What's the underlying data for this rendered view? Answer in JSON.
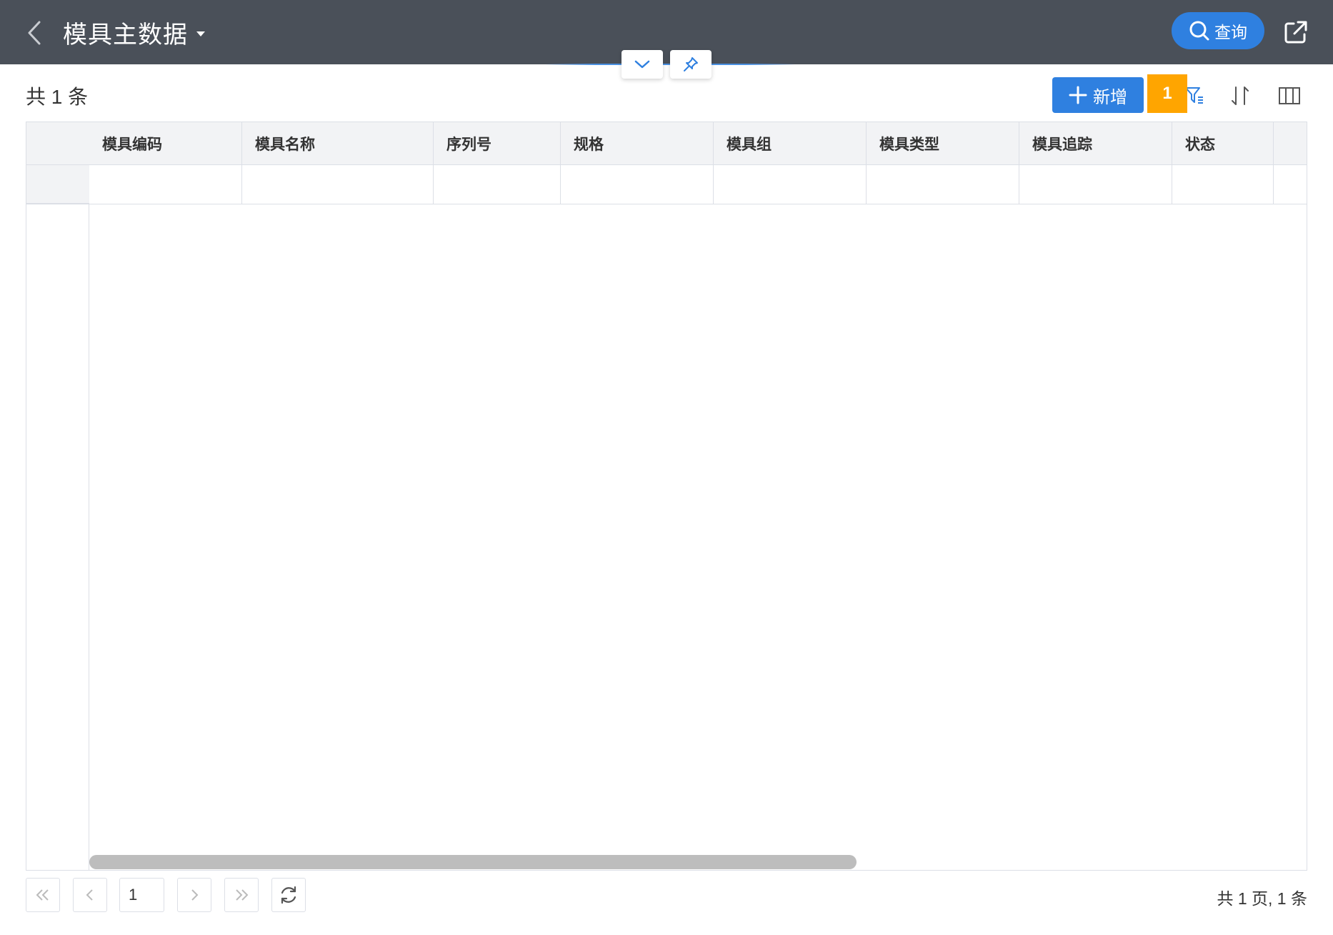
{
  "header": {
    "title": "模具主数据",
    "query_label": "查询"
  },
  "toolbar": {
    "count_text": "共 1 条",
    "add_label": "新增",
    "badge": "1"
  },
  "table": {
    "columns": [
      "模具编码",
      "模具名称",
      "序列号",
      "规格",
      "模具组",
      "模具类型",
      "模具追踪",
      "状态"
    ]
  },
  "pagination": {
    "current_page": "1",
    "summary": "共 1 页, 1 条"
  },
  "colors": {
    "header_bg": "#4a5059",
    "accent": "#2f80e0",
    "badge": "#ffa500"
  },
  "icons": [
    "back-arrow-icon",
    "caret-down-icon",
    "search-icon",
    "share-icon",
    "chevron-down-icon",
    "pin-icon",
    "plus-icon",
    "filter-icon",
    "sort-icon",
    "columns-icon",
    "first-page-icon",
    "prev-page-icon",
    "next-page-icon",
    "last-page-icon",
    "refresh-icon"
  ]
}
